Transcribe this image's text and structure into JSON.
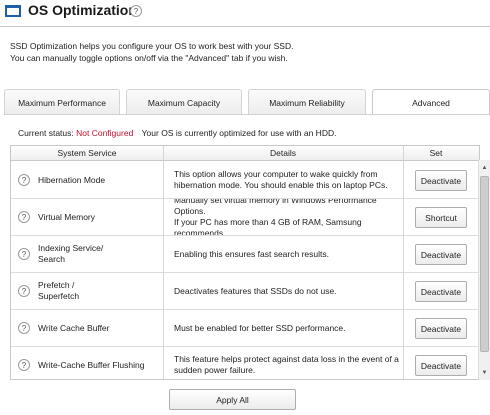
{
  "header": {
    "title": "OS Optimization",
    "help": "?"
  },
  "description": {
    "line1": "SSD Optimization helps you configure your OS to work best with your SSD.",
    "line2": "You can manually toggle options on/off via the \"Advanced\" tab if you wish."
  },
  "tabs": [
    {
      "label": "Maximum Performance"
    },
    {
      "label": "Maximum Capacity"
    },
    {
      "label": "Maximum Reliability"
    },
    {
      "label": "Advanced"
    }
  ],
  "active_tab": "Advanced",
  "status": {
    "prefix": "Current status:",
    "value": "Not Configured",
    "message": "Your OS is currently optimized for use with an HDD."
  },
  "table": {
    "columns": [
      "System Service",
      "Details",
      "Set"
    ],
    "rows": [
      {
        "help": "?",
        "service": "Hibernation Mode",
        "details": "This option allows your computer to wake quickly from\nhibernation mode. You should enable this on laptop PCs.",
        "button": "Deactivate"
      },
      {
        "help": "?",
        "service": "Virtual Memory",
        "details": "Manually set virtual memory in Windows Performance Options.\nIf your PC has more than 4 GB of RAM, Samsung recommends ...",
        "button": "Shortcut"
      },
      {
        "help": "?",
        "service": "Indexing Service/\nSearch",
        "details": "Enabling this ensures fast search results.",
        "button": "Deactivate"
      },
      {
        "help": "?",
        "service": "Prefetch /\nSuperfetch",
        "details": "Deactivates features that SSDs do not use.",
        "button": "Deactivate"
      },
      {
        "help": "?",
        "service": "Write Cache Buffer",
        "details": "Must be enabled for better SSD performance.",
        "button": "Deactivate"
      },
      {
        "help": "?",
        "service": "Write-Cache Buffer Flushing",
        "details": "This feature helps protect against data loss in the event of a\nsudden power failure.",
        "button": "Deactivate"
      }
    ]
  },
  "scrollbar": {
    "up": "▲",
    "down": "▼"
  },
  "apply_all_label": "Apply All",
  "colors": {
    "accent": "#1f5fa8",
    "status_alert": "#c8102e"
  }
}
